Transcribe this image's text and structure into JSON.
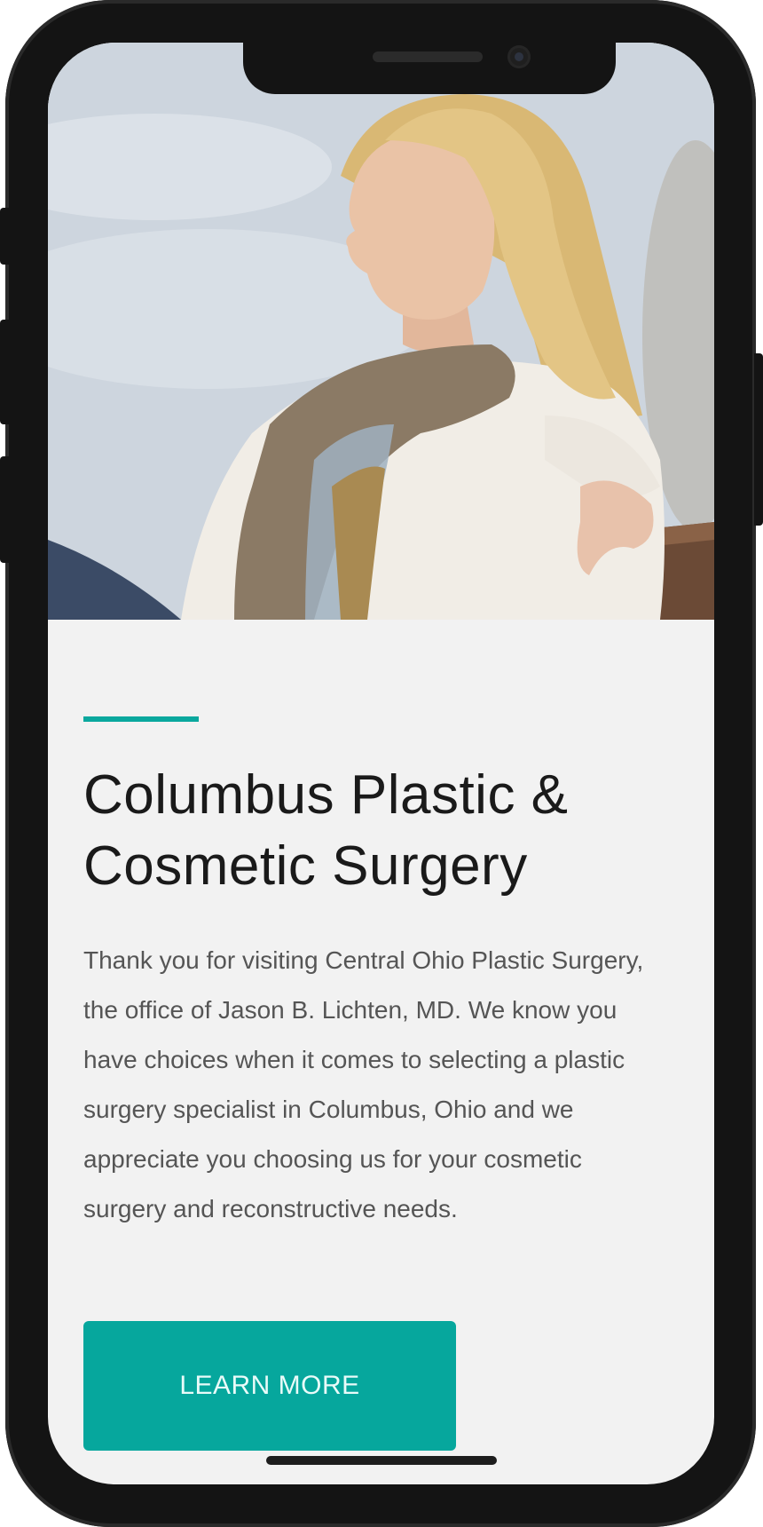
{
  "hero": {
    "icon": "hero-photo-woman-outdoors"
  },
  "content": {
    "title": "Columbus Plastic & Cosmetic Surgery",
    "body": "Thank you for visiting Central Ohio Plastic Surgery, the office of Jason B. Lichten, MD. We know you have choices when it comes to selecting a plastic surgery specialist in Columbus, Ohio and we appreciate you choosing us for your cosmetic surgery and reconstructive needs.",
    "cta_label": "LEARN MORE"
  },
  "colors": {
    "accent": "#0aa89e",
    "button": "#06a79d",
    "background": "#f2f2f2",
    "title_text": "#1a1a1a",
    "body_text": "#555555"
  }
}
